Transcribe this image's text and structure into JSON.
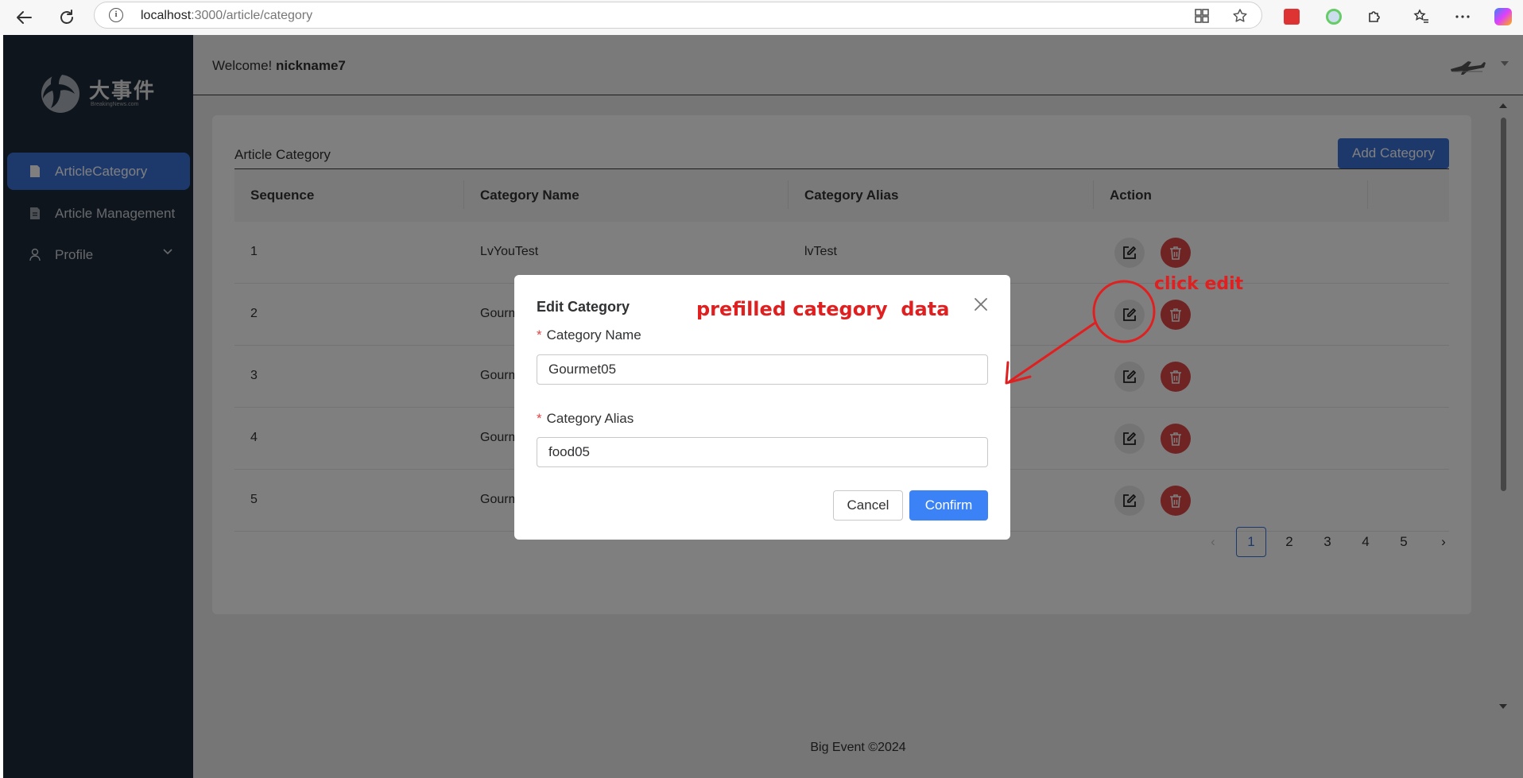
{
  "browser": {
    "url_host": "localhost",
    "url_rest": ":3000/article/category"
  },
  "sidebar": {
    "logo_text": "大事件",
    "logo_sub": "BreakingNews.com",
    "items": [
      {
        "label": "ArticleCategory",
        "icon": "document-icon",
        "active": true
      },
      {
        "label": "Article Management",
        "icon": "file-icon",
        "active": false
      },
      {
        "label": "Profile",
        "icon": "user-icon",
        "active": false
      }
    ]
  },
  "header": {
    "welcome_prefix": "Welcome! ",
    "username": "nickname7"
  },
  "card": {
    "title": "Article Category",
    "add_button": "Add Category"
  },
  "table": {
    "headers": [
      "Sequence",
      "Category Name",
      "Category Alias",
      "Action"
    ],
    "rows": [
      {
        "seq": "1",
        "name": "LvYouTest",
        "alias": "lvTest"
      },
      {
        "seq": "2",
        "name": "Gourm",
        "alias": ""
      },
      {
        "seq": "3",
        "name": "Gourm",
        "alias": ""
      },
      {
        "seq": "4",
        "name": "Gourm",
        "alias": ""
      },
      {
        "seq": "5",
        "name": "Gourm",
        "alias": ""
      }
    ]
  },
  "pagination": {
    "pages": [
      "1",
      "2",
      "3",
      "4",
      "5"
    ],
    "current": "1"
  },
  "footer": "Big Event ©2024",
  "dialog": {
    "title": "Edit Category",
    "name_label": "Category Name",
    "name_value": "Gourmet05",
    "alias_label": "Category Alias",
    "alias_value": "food05",
    "cancel": "Cancel",
    "confirm": "Confirm"
  },
  "annotations": {
    "prefilled": "prefilled category  data",
    "click_edit": "click edit",
    "color": "#e02020"
  },
  "colors": {
    "sidebar_bg": "#1e2a39",
    "accent": "#3b73d9",
    "danger": "#e04646"
  }
}
